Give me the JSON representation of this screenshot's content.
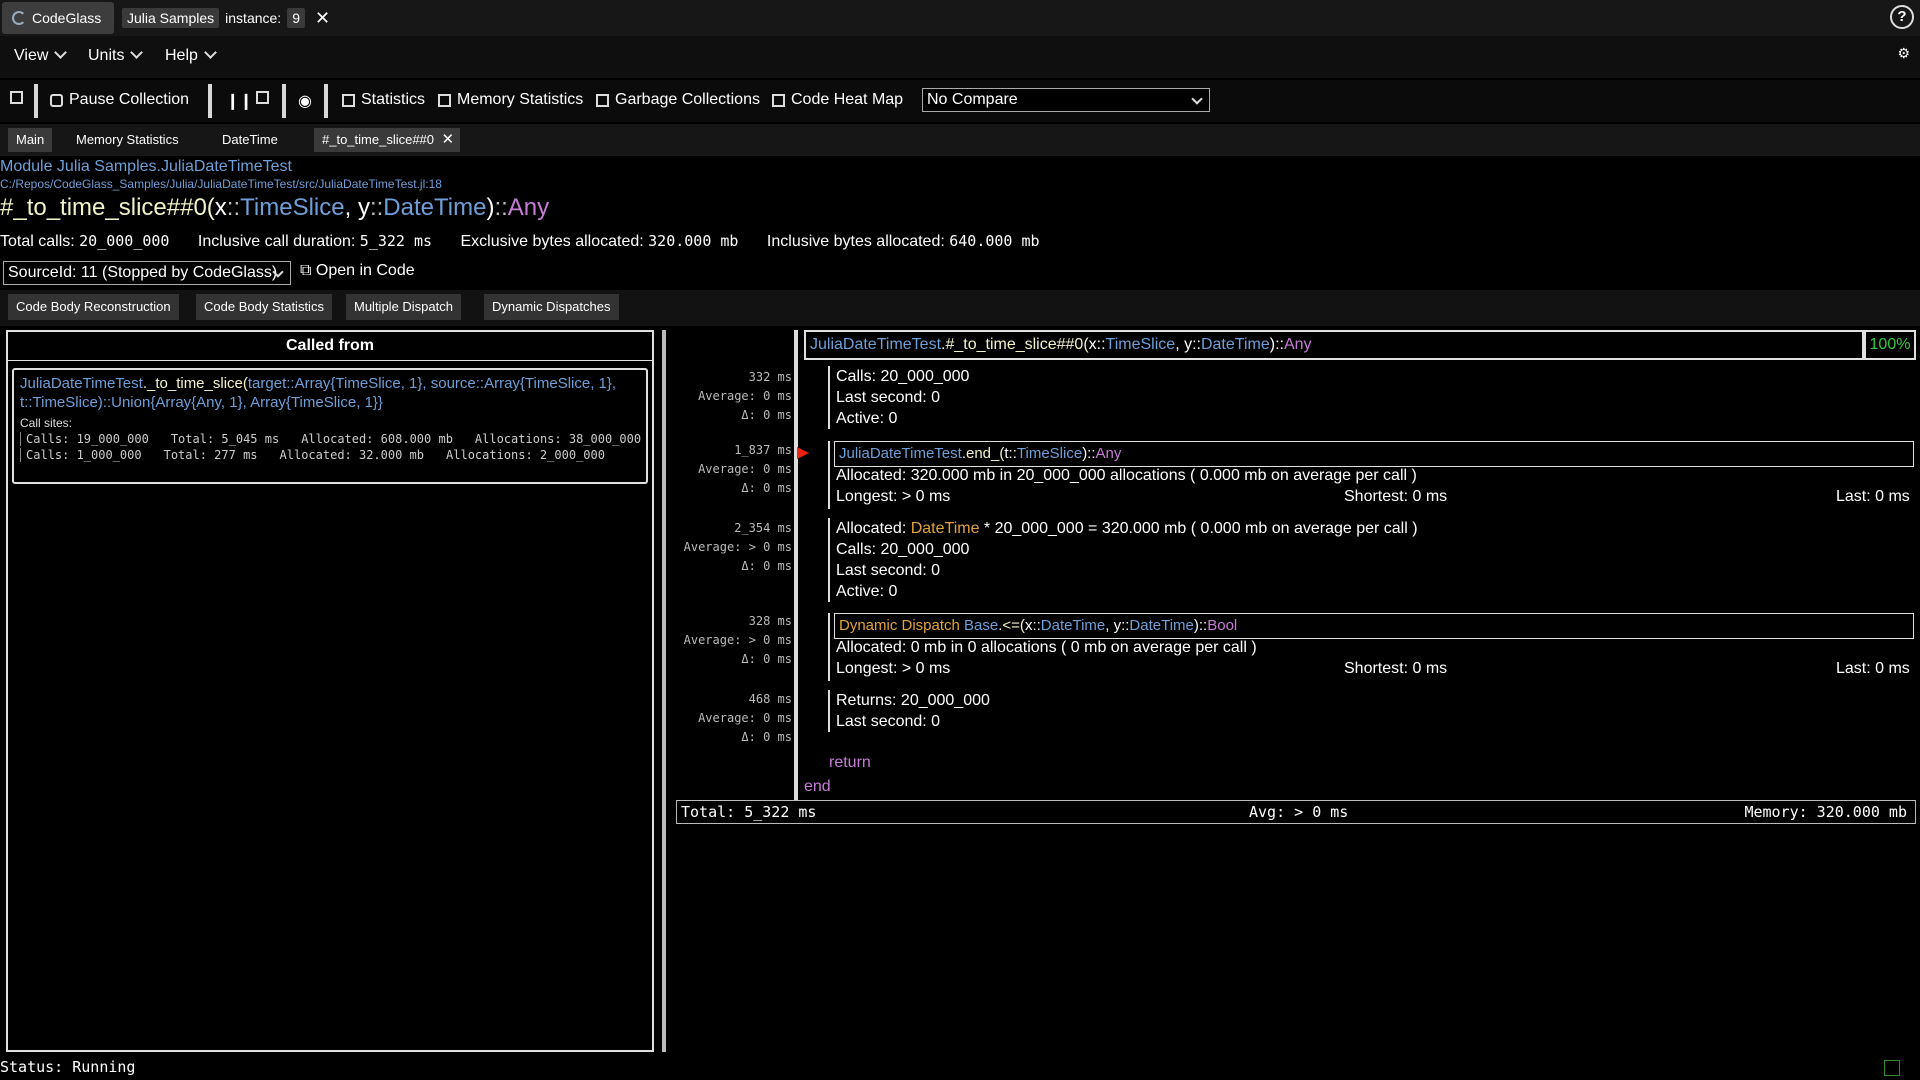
{
  "titlebar": {
    "app_name": "CodeGlass",
    "sample_name": "Julia Samples",
    "instance_label": "instance:",
    "instance_value": "9",
    "help_label": "?"
  },
  "menu": {
    "view": "View",
    "units": "Units",
    "help": "Help"
  },
  "toolbar": {
    "pause_collection": "Pause Collection",
    "statistics": "Statistics",
    "memory_statistics": "Memory Statistics",
    "garbage_collections": "Garbage Collections",
    "code_heat_map": "Code Heat Map",
    "compare_selected": "No Compare"
  },
  "doc_tabs": [
    "Main",
    "Memory Statistics",
    "DateTime",
    "#_to_time_slice##0"
  ],
  "header": {
    "module_prefix": "Module Julia Samples.",
    "module_name": "JuliaDateTimeTest",
    "file_path": "C:/Repos/CodeGlass_Samples/Julia/JuliaDateTimeTest/src/JuliaDateTimeTest.jl:18",
    "sig_name": "#_to_time_slice##0(",
    "sig_p1": "x",
    "sig_t1": "TimeSlice",
    "sig_p2": ", y",
    "sig_t2": "DateTime",
    "sig_close": ")",
    "sig_ret": "Any",
    "total_calls_label": "Total calls:",
    "total_calls": "20_000_000",
    "incl_duration_label": "Inclusive call duration:",
    "incl_duration": "5_322 ms",
    "excl_bytes_label": "Exclusive bytes allocated:",
    "excl_bytes": "320.000 mb",
    "incl_bytes_label": "Inclusive bytes allocated:",
    "incl_bytes": "640.000 mb",
    "source_select": "SourceId: 11 (Stopped by CodeGlass)",
    "open_in_code": "Open in Code"
  },
  "sub_tabs": [
    "Code Body Reconstruction",
    "Code Body Statistics",
    "Multiple Dispatch",
    "Dynamic Dispatches"
  ],
  "called_from": {
    "title": "Called from",
    "caller_mod": "JuliaDateTimeTest",
    "caller_fn": "._to_time_slice(",
    "caller_rest1": "target::Array{TimeSlice, 1}, source::Array{TimeSlice, 1},",
    "caller_rest2": "t::TimeSlice)::Union{Array{Any, 1}, Array{TimeSlice, 1}}",
    "call_sites_label": "Call sites:",
    "call_sites": [
      {
        "calls": "Calls: 19_000_000",
        "total": "Total: 5_045 ms",
        "allocated": "Allocated: 608.000 mb",
        "allocations": "Allocations: 38_000_000"
      },
      {
        "calls": "Calls: 1_000_000",
        "total": "Total: 277 ms",
        "allocated": "Allocated: 32.000 mb",
        "allocations": "Allocations: 2_000_000"
      }
    ]
  },
  "gutter": [
    {
      "time": "332 ms",
      "avg": "Average: 0 ms",
      "delta": "Δ: 0 ms"
    },
    {
      "time": "1_837 ms",
      "avg": "Average: 0 ms",
      "delta": "Δ: 0 ms"
    },
    {
      "time": "2_354 ms",
      "avg": "Average: > 0 ms",
      "delta": "Δ: 0 ms"
    },
    {
      "time": "328 ms",
      "avg": "Average: > 0 ms",
      "delta": "Δ: 0 ms"
    },
    {
      "time": "468 ms",
      "avg": "Average: 0 ms",
      "delta": "Δ: 0 ms"
    }
  ],
  "code": {
    "header_mod": "JuliaDateTimeTest",
    "header_fn": ".#_to_time_slice##0(",
    "header_p1": "x::",
    "header_t1": "TimeSlice",
    "header_p2": ", y::",
    "header_t2": "DateTime",
    "header_close": ")::",
    "header_ret": "Any",
    "percent": "100%",
    "b1_calls": "Calls: 20_000_000",
    "b1_last": "Last second: 0",
    "b1_active": "Active: 0",
    "call_mod": "JuliaDateTimeTest",
    "call_fn": ".end_(",
    "call_p": "t::",
    "call_t": "TimeSlice",
    "call_close": ")::",
    "call_ret": "Any",
    "b2_alloc": "Allocated: 320.000 mb in 20_000_000 allocations ( 0.000 mb on average per call )",
    "b2_longest": "Longest: > 0 ms",
    "b2_shortest": "Shortest: 0 ms",
    "b2_last": "Last: 0 ms",
    "b3_alloc_pre": "Allocated: ",
    "b3_alloc_type": "DateTime",
    "b3_alloc_post": " * 20_000_000 = 320.000 mb ( 0.000 mb on average per call )",
    "b3_calls": "Calls: 20_000_000",
    "b3_last": "Last second: 0",
    "b3_active": "Active: 0",
    "dd_label": "Dynamic Dispatch",
    "dd_mod": "Base",
    "dd_fn": ".<=(",
    "dd_p1": "x::",
    "dd_t1": "DateTime",
    "dd_p2": ", y::",
    "dd_t2": "DateTime",
    "dd_close": ")::",
    "dd_ret": "Bool",
    "b4_alloc": "Allocated: 0 mb in 0 allocations ( 0 mb on average per call )",
    "b4_longest": "Longest: > 0 ms",
    "b4_shortest": "Shortest: 0 ms",
    "b4_last": "Last: 0 ms",
    "b5_returns": "Returns: 20_000_000",
    "b5_last": "Last second: 0",
    "return_kw": "return",
    "end_kw": "end"
  },
  "totals": {
    "total": "Total: 5_322 ms",
    "avg": "Avg: > 0 ms",
    "memory": "Memory: 320.000 mb"
  },
  "status": "Status: Running",
  "colors": {
    "type": "#6e9fd8",
    "keyword": "#c77cd8",
    "accent": "#e3a33a",
    "percent": "#2ecc40"
  }
}
